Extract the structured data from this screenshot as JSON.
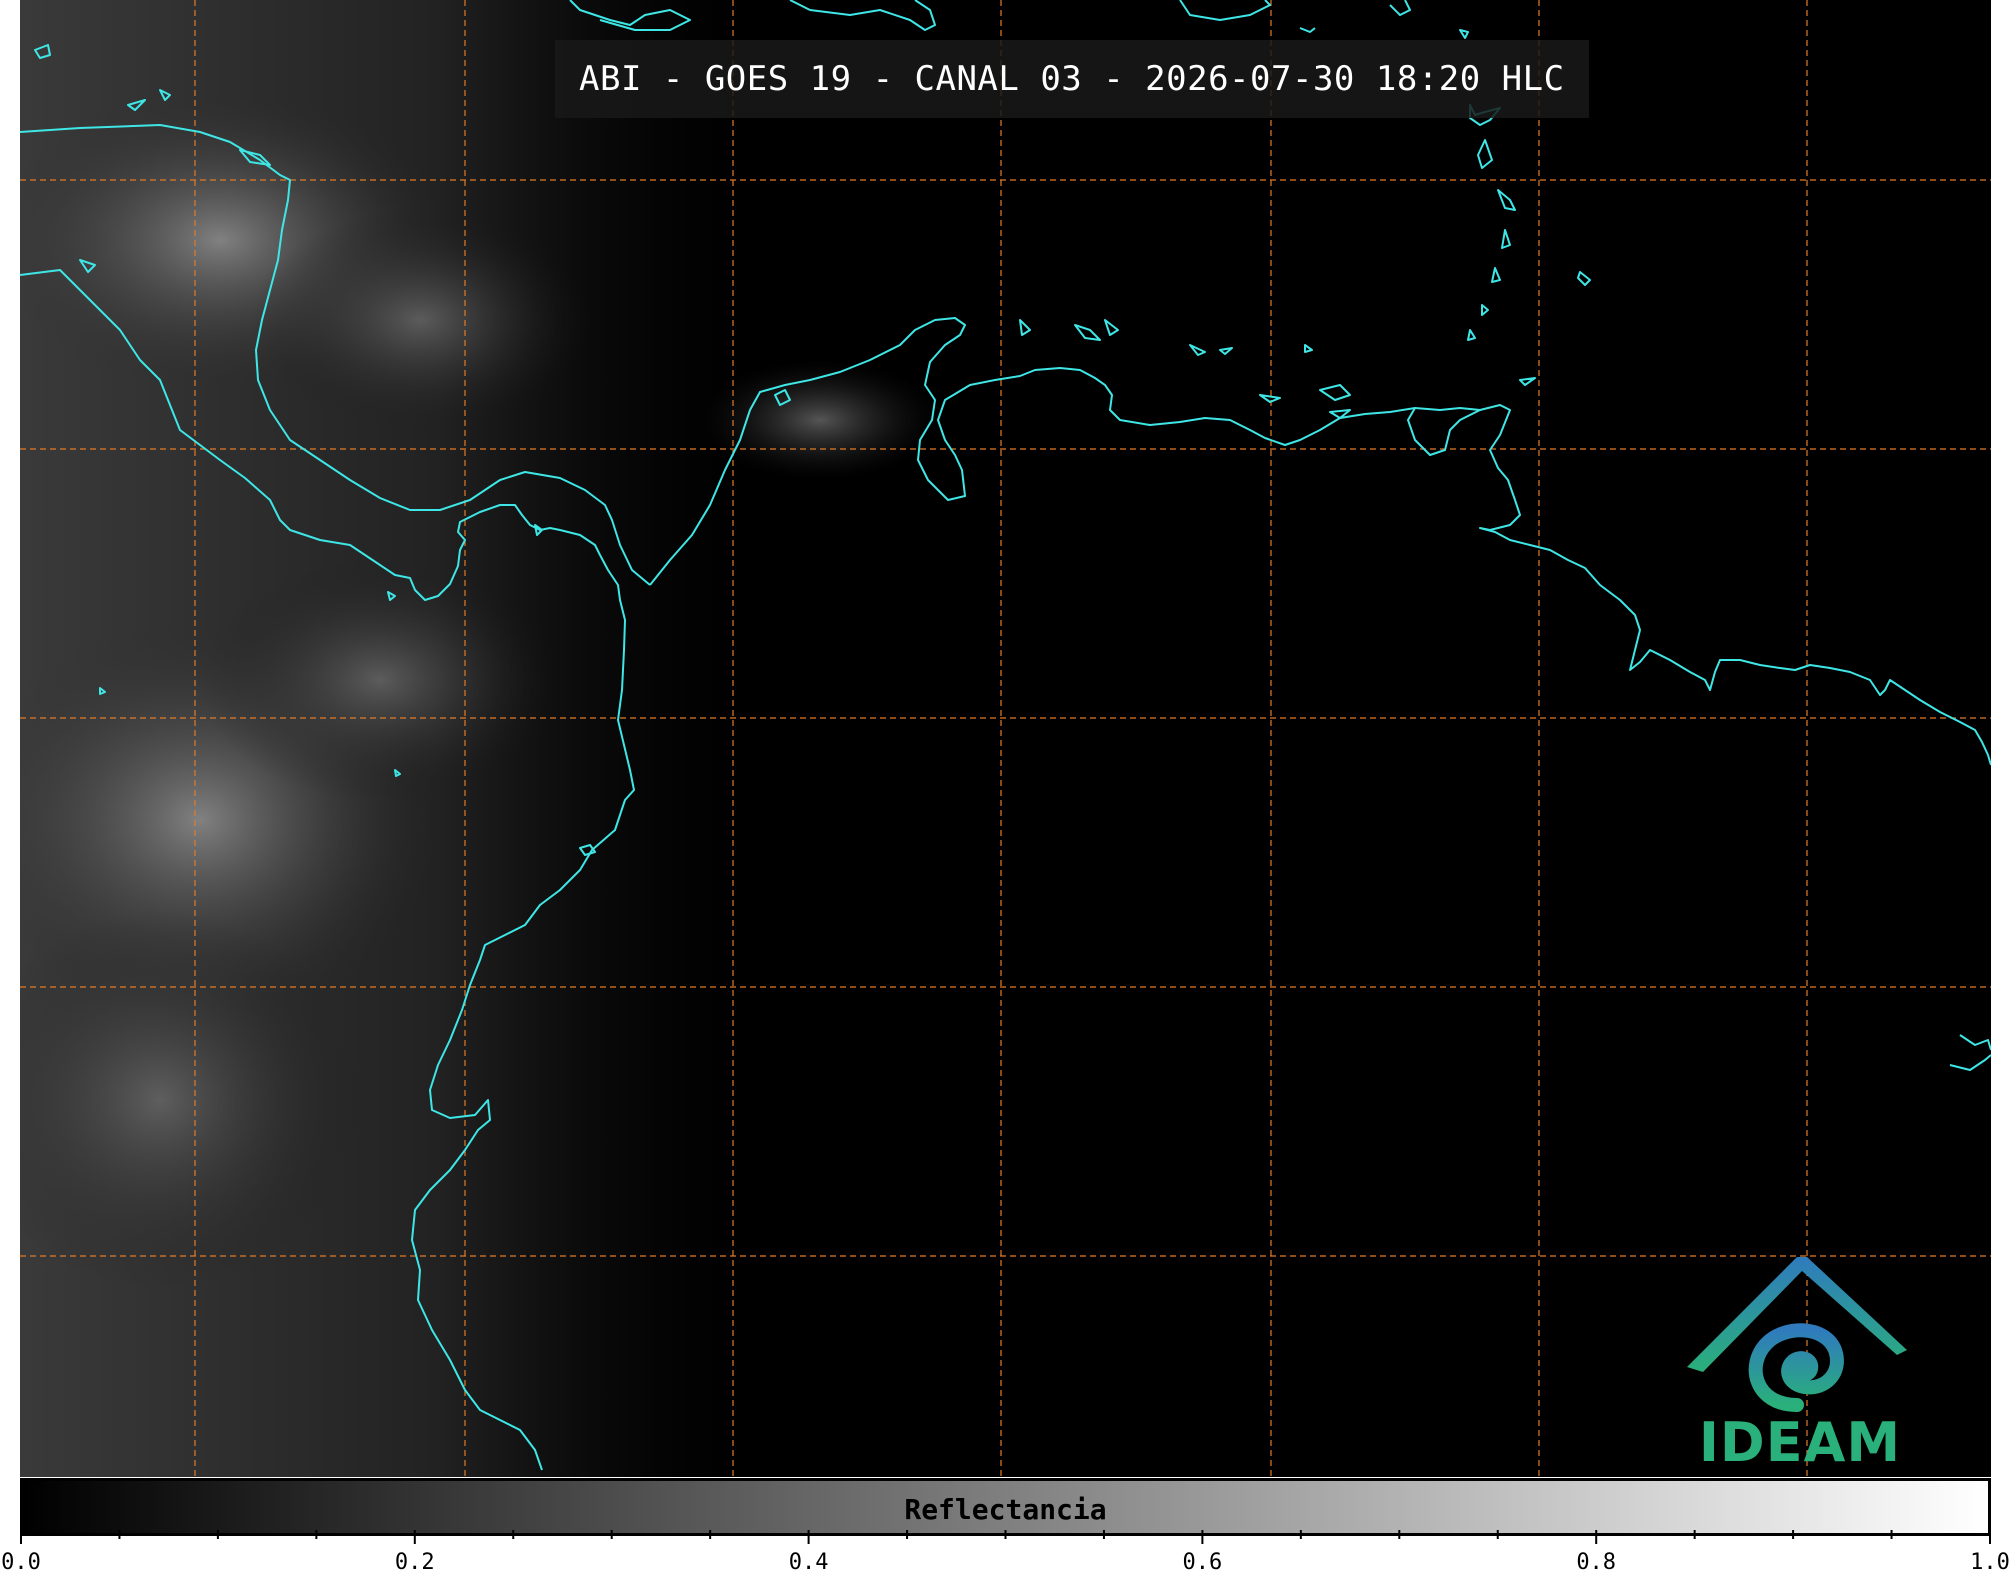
{
  "title": "ABI - GOES 19 - CANAL 03 - 2026-07-30 18:20 HLC",
  "logo": {
    "text": "IDEAM",
    "icon": "ideam-logo-icon",
    "colors": {
      "top": "#2f7bbd",
      "bottom": "#2ab07a"
    }
  },
  "colorbar": {
    "label": "Reflectancia",
    "min": 0.0,
    "max": 1.0,
    "tick_labels": [
      "0.0",
      "0.2",
      "0.4",
      "0.6",
      "0.8",
      "1.0"
    ],
    "colors": {
      "low": "#000000",
      "high": "#ffffff"
    }
  },
  "map": {
    "coastline_color": "#3fe6e6",
    "gridline_color": "#e07b2a",
    "gridline_style": "dashed",
    "background": "#000000"
  }
}
